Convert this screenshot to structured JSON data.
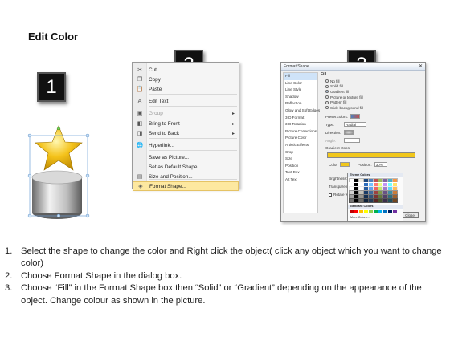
{
  "title": "Edit Color",
  "badges": [
    "1",
    "2",
    "3"
  ],
  "context_menu": {
    "items": [
      {
        "icon": "scissors-icon",
        "glyph": "✂",
        "label": "Cut",
        "disabled": false,
        "submenu": false
      },
      {
        "icon": "copy-icon",
        "glyph": "❐",
        "label": "Copy",
        "disabled": false,
        "submenu": false
      },
      {
        "icon": "paste-icon",
        "glyph": "📋",
        "label": "Paste",
        "disabled": false,
        "submenu": false
      },
      {
        "icon": "edit-text-icon",
        "glyph": "A",
        "label": "Edit Text",
        "disabled": false,
        "submenu": false
      },
      {
        "icon": "group-icon",
        "glyph": "▣",
        "label": "Group",
        "disabled": true,
        "submenu": true
      },
      {
        "icon": "bring-front-icon",
        "glyph": "◧",
        "label": "Bring to Front",
        "disabled": false,
        "submenu": true
      },
      {
        "icon": "send-back-icon",
        "glyph": "◨",
        "label": "Send to Back",
        "disabled": false,
        "submenu": true
      },
      {
        "icon": "hyperlink-icon",
        "glyph": "🌐",
        "label": "Hyperlink...",
        "disabled": false,
        "submenu": false
      },
      {
        "icon": "",
        "glyph": "",
        "label": "Save as Picture...",
        "disabled": false,
        "submenu": false
      },
      {
        "icon": "",
        "glyph": "",
        "label": "Set as Default Shape",
        "disabled": false,
        "submenu": false
      },
      {
        "icon": "size-position-icon",
        "glyph": "▤",
        "label": "Size and Position...",
        "disabled": false,
        "submenu": false
      },
      {
        "icon": "format-shape-icon",
        "glyph": "◈",
        "label": "Format Shape...",
        "disabled": false,
        "submenu": false,
        "highlighted": true
      }
    ]
  },
  "dialog": {
    "title": "Format Shape",
    "sidebar": [
      "Fill",
      "Line Color",
      "Line Style",
      "Shadow",
      "Reflection",
      "Glow and Soft Edges",
      "3-D Format",
      "3-D Rotation",
      "Picture Corrections",
      "Picture Color",
      "Artistic Effects",
      "Crop",
      "Size",
      "Position",
      "Text Box",
      "Alt Text"
    ],
    "section": "Fill",
    "fill_options": [
      "No fill",
      "Solid fill",
      "Gradient fill",
      "Picture or texture fill",
      "Pattern fill",
      "Slide background fill"
    ],
    "selected_fill": 2,
    "preset_colors": "Preset colors:",
    "type_label": "Type:",
    "type_value": "Radial",
    "direction_label": "Direction:",
    "angle_label": "Angle:",
    "gradient_stops": "Gradient stops",
    "color_label": "Color",
    "position_label": "Position:",
    "position_value": "30%",
    "brightness_label": "Brightness:",
    "transparency_label": "Transparency:",
    "rotate_label": "Rotate with shape",
    "close": "Close"
  },
  "palette": {
    "theme_header": "Theme Colors",
    "theme_colors": [
      "#ffffff",
      "#000000",
      "#eeece1",
      "#1f497d",
      "#4f81bd",
      "#c0504d",
      "#9bbb59",
      "#8064a2",
      "#4bacc6",
      "#f79646"
    ],
    "standard_header": "Standard Colors",
    "standard_colors": [
      "#c00000",
      "#ff0000",
      "#ffc000",
      "#ffff00",
      "#92d050",
      "#00b050",
      "#00b0f0",
      "#0070c0",
      "#002060",
      "#7030a0"
    ],
    "more": "More Colors..."
  },
  "instructions": [
    {
      "num": "1.",
      "text": "Select the shape to change the color and Right click the object( click any object which you want to change color)"
    },
    {
      "num": "2.",
      "text": "Choose Format Shape in the dialog box."
    },
    {
      "num": "3.",
      "text": "Choose “Fill” in the Format Shape box then “Solid” or “Gradient” depending on the appearance of the object. Change colour as shown in the picture."
    }
  ]
}
